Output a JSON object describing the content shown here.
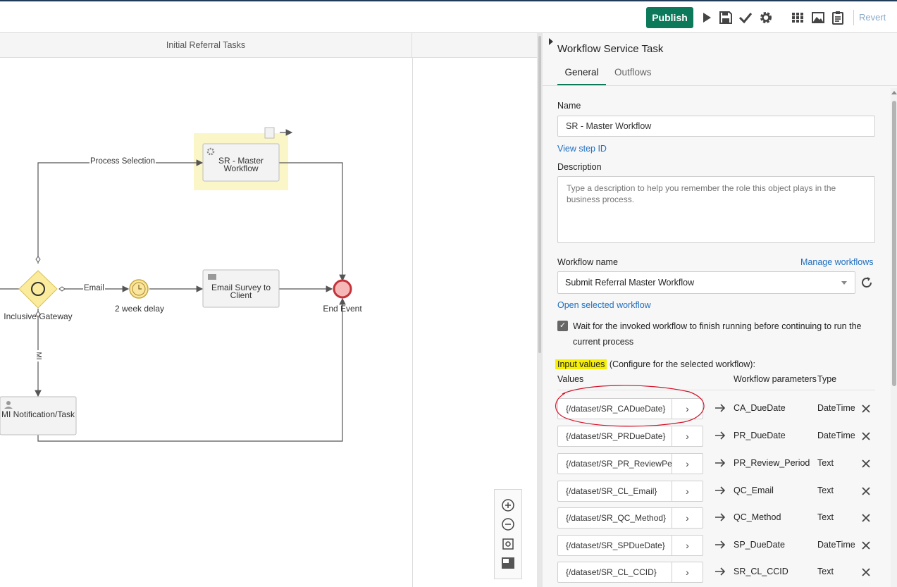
{
  "toolbar": {
    "publish_label": "Publish",
    "revert_label": "Revert",
    "icons": [
      "play-icon",
      "save-icon",
      "check-icon",
      "gear-icon",
      "grid-icon",
      "image-icon",
      "clipboard-icon"
    ]
  },
  "canvas": {
    "lane_title": "Initial Referral Tasks",
    "nodes": {
      "task_sr": "SR - Master Workflow",
      "task_email": "Email Survey to Client",
      "task_mi": "MI Notification/Task",
      "gateway": "Inclusive Gateway",
      "timer": "2 week delay",
      "end_event": "End Event"
    },
    "edges": {
      "process_selection": "Process Selection",
      "email": "Email",
      "mi": "MI"
    }
  },
  "panel": {
    "title": "Workflow Service Task",
    "tabs": [
      "General",
      "Outflows"
    ],
    "active_tab": "General",
    "name_label": "Name",
    "name_value": "SR - Master Workflow",
    "view_step_id": "View step ID",
    "description_label": "Description",
    "description_placeholder": "Type a description to help you remember the role this object plays in the business process.",
    "workflow_name_label": "Workflow name",
    "manage_workflows": "Manage workflows",
    "workflow_selected": "Submit Referral Master Workflow",
    "open_selected": "Open selected workflow",
    "wait_checkbox_label": "Wait for the invoked workflow to finish running before continuing to run the current process",
    "wait_checked": true,
    "input_values_title": "Input values",
    "input_values_suffix": " (Configure for the selected workflow):",
    "col_values": "Values",
    "col_params": "Workflow parameters",
    "col_type": "Type",
    "highlight_color": "#f6ef00",
    "accent_color": "#0c7a5a",
    "rows": [
      {
        "value": "{/dataset/SR_CADueDate}",
        "param": "CA_DueDate",
        "type": "DateTime"
      },
      {
        "value": "{/dataset/SR_PRDueDate}",
        "param": "PR_DueDate",
        "type": "DateTime"
      },
      {
        "value": "{/dataset/SR_PR_ReviewPeriod}",
        "param": "PR_Review_Period",
        "type": "Text"
      },
      {
        "value": "{/dataset/SR_CL_Email}",
        "param": "QC_Email",
        "type": "Text"
      },
      {
        "value": "{/dataset/SR_QC_Method}",
        "param": "QC_Method",
        "type": "Text"
      },
      {
        "value": "{/dataset/SR_SPDueDate}",
        "param": "SP_DueDate",
        "type": "DateTime"
      },
      {
        "value": "{/dataset/SR_CL_CCID}",
        "param": "SR_CL_CCID",
        "type": "Text"
      }
    ]
  }
}
